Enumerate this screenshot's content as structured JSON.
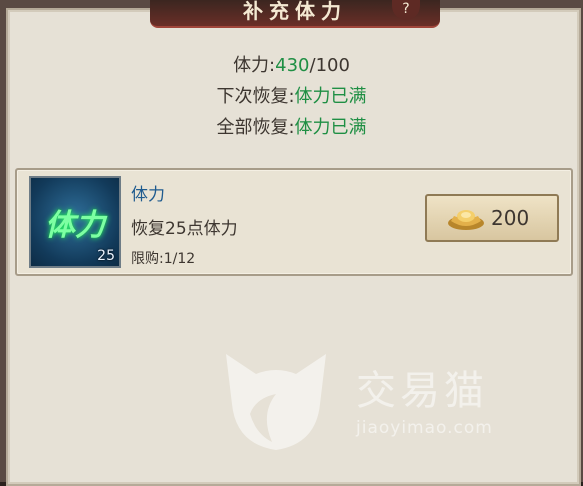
{
  "title": "补充体力",
  "help": "?",
  "stamina": {
    "label": "体力:",
    "current": "430",
    "sep": "/",
    "max": "100"
  },
  "next_recover": {
    "label": "下次恢复:",
    "value": "体力已满"
  },
  "all_recover": {
    "label": "全部恢复:",
    "value": "体力已满"
  },
  "item": {
    "icon_text": "体力",
    "count": "25",
    "name": "体力",
    "description": "恢复25点体力",
    "limit": "限购:1/12",
    "price": "200",
    "currency_icon": "gold-ingot-icon"
  },
  "watermark": {
    "text": "交易猫",
    "url": "jiaoyimao.com"
  },
  "colors": {
    "accent_green": "#1f8f44",
    "name_blue": "#1f5b8f",
    "panel_bg": "#e6e1d6"
  }
}
